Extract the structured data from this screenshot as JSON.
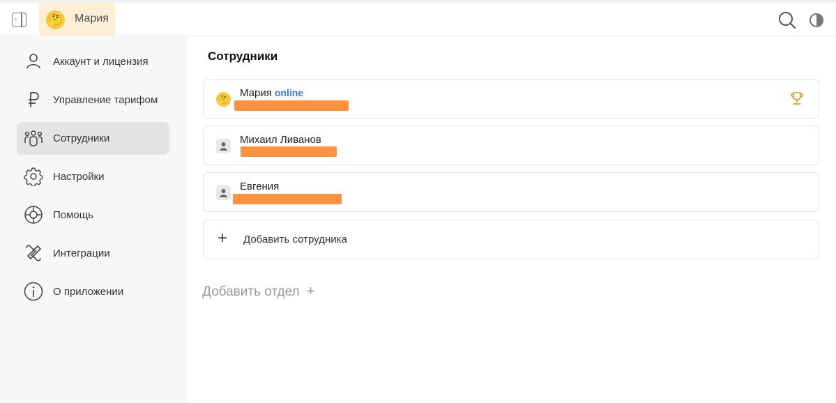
{
  "topbar": {
    "user_name": "Мария",
    "user_avatar_emoji": "🤔"
  },
  "sidebar": {
    "items": [
      {
        "label": "Аккаунт и лицензия",
        "icon": "user-icon"
      },
      {
        "label": "Управление тарифом",
        "icon": "ruble-icon"
      },
      {
        "label": "Сотрудники",
        "icon": "team-icon",
        "active": true
      },
      {
        "label": "Настройки",
        "icon": "gear-icon"
      },
      {
        "label": "Помощь",
        "icon": "lifebuoy-icon"
      },
      {
        "label": "Интеграции",
        "icon": "link-icon"
      },
      {
        "label": "О приложении",
        "icon": "info-icon"
      }
    ]
  },
  "main": {
    "title": "Сотрудники",
    "employees": [
      {
        "name": "Мария",
        "status": "online",
        "avatar": "🤔"
      },
      {
        "name": "Михаил Ливанов"
      },
      {
        "name": "Евгения"
      }
    ],
    "add_employee": "Добавить сотрудника",
    "add_department": "Добавить отдел",
    "add_department_plus": "+",
    "add_employee_plus": "+"
  },
  "colors": {
    "accent_online": "#3a7bd5",
    "redaction": "#ff9240",
    "chip_bg": "#fdefd5",
    "trophy": "#d59b2a"
  }
}
